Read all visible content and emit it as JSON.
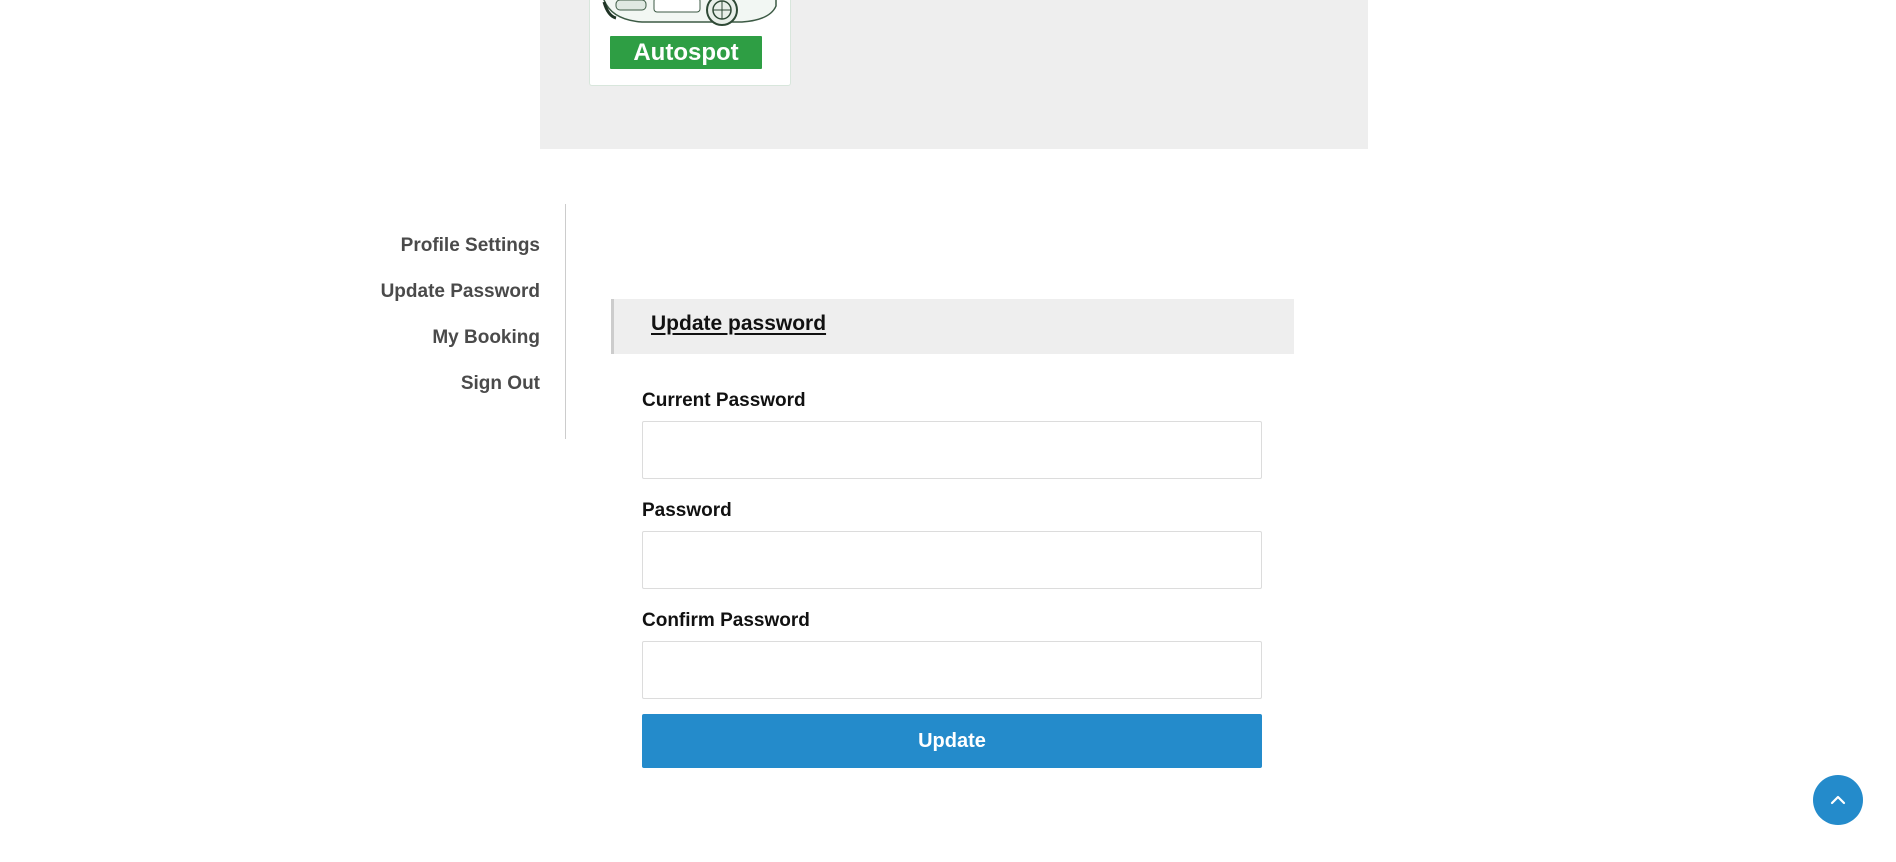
{
  "header": {
    "brand": "Autospot"
  },
  "sidebar": {
    "items": [
      {
        "label": "Profile Settings"
      },
      {
        "label": "Update Password"
      },
      {
        "label": "My Booking"
      },
      {
        "label": "Sign Out"
      }
    ]
  },
  "form": {
    "title": "Update password",
    "fields": [
      {
        "label": "Current Password",
        "value": ""
      },
      {
        "label": "Password",
        "value": ""
      },
      {
        "label": "Confirm Password",
        "value": ""
      }
    ],
    "submit_label": "Update"
  },
  "colors": {
    "brand_green": "#2e9e44",
    "primary_blue": "#248bcb",
    "panel_grey": "#eeeeee"
  },
  "icons": {
    "back_to_top": "chevron-up-icon"
  }
}
